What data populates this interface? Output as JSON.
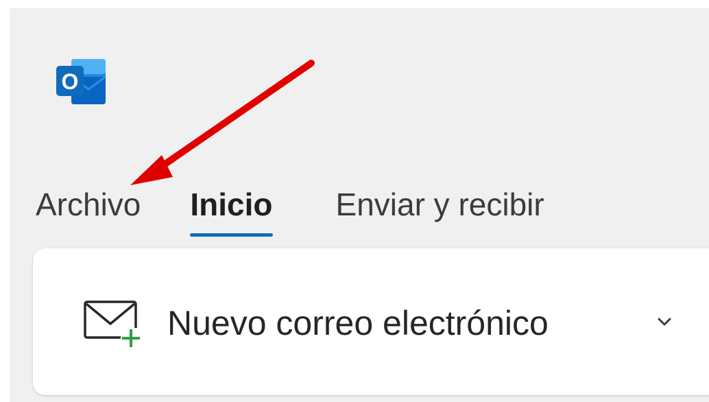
{
  "app": {
    "name": "Outlook",
    "logo_letter": "O",
    "brand_color": "#0f6cbd"
  },
  "tabs": [
    {
      "label": "Archivo",
      "active": false
    },
    {
      "label": "Inicio",
      "active": true
    },
    {
      "label": "Enviar y recibir",
      "active": false
    }
  ],
  "ribbon": {
    "new_email_label": "Nuevo correo electrónico",
    "new_email_icon": "envelope-plus-icon",
    "dropdown_icon": "chevron-down-icon"
  },
  "annotation": {
    "arrow_color": "#e00000",
    "arrow_icon": "red-arrow-annotation",
    "target": "Archivo"
  }
}
